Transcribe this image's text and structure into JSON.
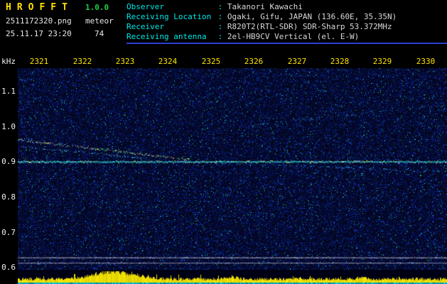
{
  "app": {
    "title": "HROFFT",
    "version": "1.0.0",
    "filename": "2511172320.png",
    "mode": "meteor",
    "datetime": "25.11.17 23:20",
    "count": "74"
  },
  "metadata": {
    "separator": " : ",
    "rows": [
      {
        "label": "Observer",
        "value": "Takanori Kawachi"
      },
      {
        "label": "Receiving Location",
        "value": "Ogaki, Gifu, JAPAN (136.60E, 35.35N)"
      },
      {
        "label": "Receiver",
        "value": "R820T2(RTL-SDR) SDR-Sharp 53.372MHz"
      },
      {
        "label": "Receiving antenna",
        "value": "2el-HB9CV Vertical (el. E-W)"
      }
    ]
  },
  "colors": {
    "title_yellow": "#ffe000",
    "version_green": "#22cc44",
    "label_cyan": "#00e7e7",
    "value_gray": "#d8d8d8",
    "time_tick_yellow": "#ffe600",
    "freq_tick_white": "#f0f0f0",
    "header_separator_blue": "#2a3fd4",
    "spectrogram_background": "#000030",
    "carrier_cyan": "#00e0ff",
    "power_bar_yellow": "#ffee00"
  },
  "chart_data": {
    "type": "heatmap",
    "title": "HROFFT 10-minute radio meteor spectrogram, 25.11.17 23:20, 74 echo count",
    "description": "Dark blue noise field with a bright cyan carrier line at 0.90 kHz across the full 10 minutes, bright multicolour doppler trace descending from 0.96 kHz at 23:21 toward the carrier, several faint diagonal traces, two thin white horizontal lines near 0.62-0.63 kHz, and a yellow signal-strength strip along the bottom with a burst near 23:22.",
    "x_axis": {
      "unit": "hhmm",
      "ticks": [
        "2321",
        "2322",
        "2323",
        "2324",
        "2325",
        "2326",
        "2327",
        "2328",
        "2329",
        "2330"
      ]
    },
    "y_axis": {
      "label": "kHz",
      "ticks": [
        "1.1",
        "1.0",
        "0.9",
        "0.8",
        "0.7",
        "0.6"
      ],
      "top_khz": 1.165,
      "bottom_khz": 0.593
    },
    "noise": {
      "background": "#000030",
      "mid_blue_prob": 0.3,
      "bright_blue_prob": 0.06,
      "cyan_prob": 0.012,
      "green_prob": 0.003,
      "seed": 20251117
    },
    "features": [
      {
        "kind": "horizontal",
        "f": 0.9,
        "x0": 0.0,
        "x1": 1.0,
        "base_color": "#00e0ff",
        "palette": [
          "#00ffff",
          "#ffffff",
          "#66ffcc",
          "#baffb0",
          "#ffff66"
        ],
        "density": 0.95,
        "spread": 1.6,
        "label": "carrier line at 0.90 kHz"
      },
      {
        "kind": "diagonal",
        "x0": 0.0,
        "f0": 0.963,
        "x1": 0.4,
        "f1": 0.906,
        "palette": [
          "#55ff55",
          "#ff5577",
          "#ffff77",
          "#55ffff",
          "#ffffff"
        ],
        "density": 0.75,
        "spread": 1.4,
        "label": "bright multicolour doppler trace"
      },
      {
        "kind": "diagonal",
        "x0": 0.0,
        "f0": 0.944,
        "x1": 0.3,
        "f1": 0.91,
        "palette": [
          "#33bbff",
          "#66e0ff"
        ],
        "density": 0.4,
        "spread": 1.2,
        "label": "faint trace left"
      },
      {
        "kind": "diagonal",
        "x0": 0.36,
        "f0": 0.901,
        "x1": 1.0,
        "f1": 0.873,
        "palette": [
          "#2299ff",
          "#44ccff"
        ],
        "density": 0.3,
        "spread": 1.2,
        "label": "faint trace below carrier"
      },
      {
        "kind": "diagonal",
        "x0": 0.53,
        "f0": 1.003,
        "x1": 1.0,
        "f1": 1.062,
        "palette": [
          "#2288ee",
          "#44bbff"
        ],
        "density": 0.25,
        "spread": 1.3,
        "label": "faint rising trace upper right"
      },
      {
        "kind": "horizontal",
        "f": 0.628,
        "x0": 0.0,
        "x1": 1.0,
        "base_color": "#b8b8cc",
        "palette": [
          "#d0d0e0",
          "#9090b0"
        ],
        "density": 0.5,
        "spread": 0.6,
        "label": "thin white line"
      },
      {
        "kind": "horizontal",
        "f": 0.613,
        "x0": 0.0,
        "x1": 1.0,
        "base_color": "#9898b4",
        "palette": [
          "#c0c0d4",
          "#8080a0"
        ],
        "density": 0.4,
        "spread": 0.6,
        "label": "thin white line"
      }
    ],
    "power_strip": {
      "label": "signal strength (yellow bars) with cyan baseline; burst near 23:22",
      "background": "#000014",
      "bar_color": "#ffee00",
      "baseline_color": "#00e5ff",
      "base_height": 3,
      "noise_height": 4,
      "seed": 777,
      "bumps": [
        {
          "center": 0.225,
          "sigma": 0.045,
          "height": 11
        },
        {
          "center": 0.5,
          "sigma": 0.01,
          "height": 3
        },
        {
          "center": 0.8,
          "sigma": 0.008,
          "height": 3
        }
      ]
    }
  }
}
